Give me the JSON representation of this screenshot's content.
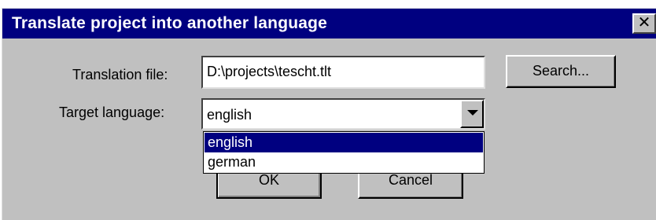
{
  "dialog": {
    "title": "Translate project into another language",
    "close_glyph": "✕"
  },
  "translation_file": {
    "label": "Translation file:",
    "value": "D:\\projects\\tescht.tlt"
  },
  "search_button": {
    "label": "Search..."
  },
  "target_language": {
    "label": "Target language:",
    "value": "english",
    "options": [
      "english",
      "german"
    ],
    "highlighted_option": "english"
  },
  "ok_button": {
    "label": "OK"
  },
  "cancel_button": {
    "label": "Cancel"
  },
  "colors": {
    "title_bar": "#000080",
    "dialog_face": "#c0c0c0",
    "selection": "#000080"
  }
}
